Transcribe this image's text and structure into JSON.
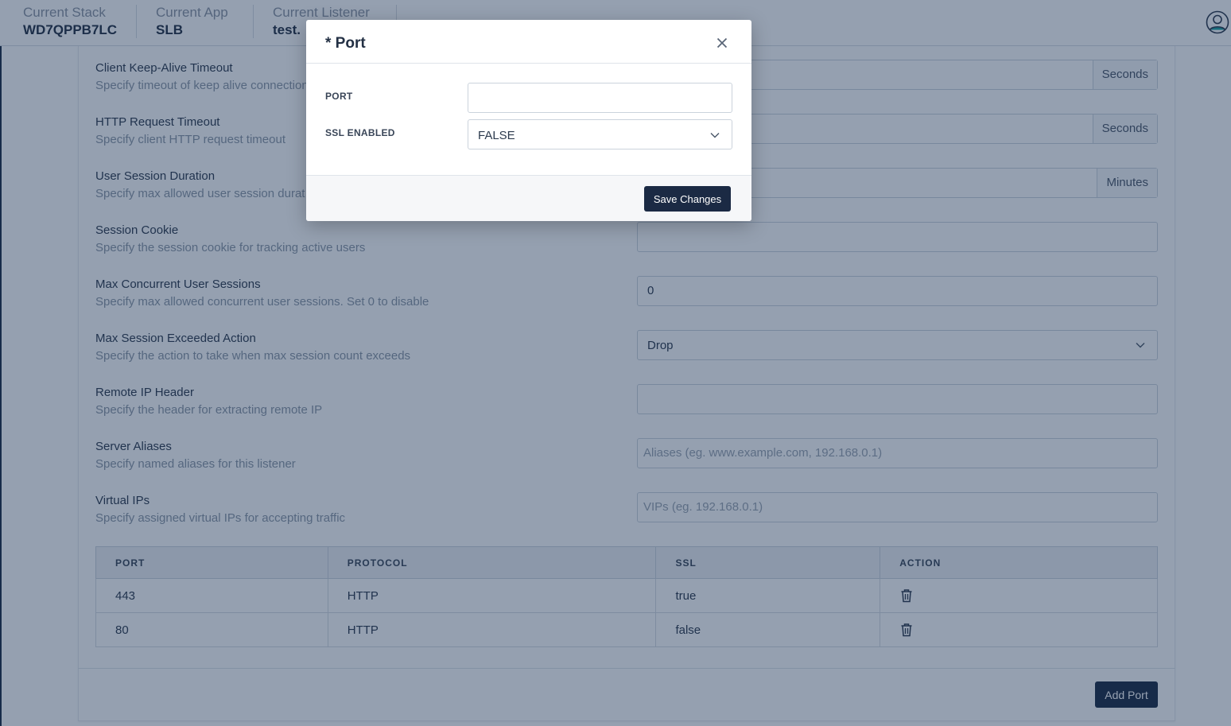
{
  "header": {
    "contexts": [
      {
        "label": "Current Stack",
        "value": "WD7QPPB7LC"
      },
      {
        "label": "Current App",
        "value": "SLB"
      },
      {
        "label": "Current Listener",
        "value": "test."
      }
    ]
  },
  "settings": [
    {
      "title": "Client Keep-Alive Timeout",
      "desc": "Specify timeout of keep alive connection",
      "value": "",
      "addon": "Seconds"
    },
    {
      "title": "HTTP Request Timeout",
      "desc": "Specify client HTTP request timeout",
      "value": "",
      "addon": "Seconds"
    },
    {
      "title": "User Session Duration",
      "desc": "Specify max allowed user session durat",
      "value": "",
      "addon": "Minutes"
    },
    {
      "title": "Session Cookie",
      "desc": "Specify the session cookie for tracking active users",
      "value": ""
    },
    {
      "title": "Max Concurrent User Sessions",
      "desc": "Specify max allowed concurrent user sessions. Set 0 to disable",
      "value": "0"
    },
    {
      "title": "Max Session Exceeded Action",
      "desc": "Specify the action to take when max session count exceeds",
      "value": "Drop"
    },
    {
      "title": "Remote IP Header",
      "desc": "Specify the header for extracting remote IP",
      "value": ""
    },
    {
      "title": "Server Aliases",
      "desc": "Specify named aliases for this listener",
      "placeholder": "Aliases (eg. www.example.com, 192.168.0.1)"
    },
    {
      "title": "Virtual IPs",
      "desc": "Specify assigned virtual IPs for accepting traffic",
      "placeholder": "VIPs (eg. 192.168.0.1)"
    }
  ],
  "ports_table": {
    "columns": [
      "PORT",
      "PROTOCOL",
      "SSL",
      "ACTION"
    ],
    "rows": [
      {
        "port": "443",
        "protocol": "HTTP",
        "ssl": "true"
      },
      {
        "port": "80",
        "protocol": "HTTP",
        "ssl": "false"
      }
    ]
  },
  "add_port_label": "Add Port",
  "modal": {
    "title": "* Port",
    "port_label": "PORT",
    "port_value": "",
    "ssl_label": "SSL ENABLED",
    "ssl_value": "FALSE",
    "save_label": "Save Changes"
  },
  "colors": {
    "primary_button": "#1b2a44",
    "overlay": "rgba(20, 45, 80, 0.45)"
  }
}
